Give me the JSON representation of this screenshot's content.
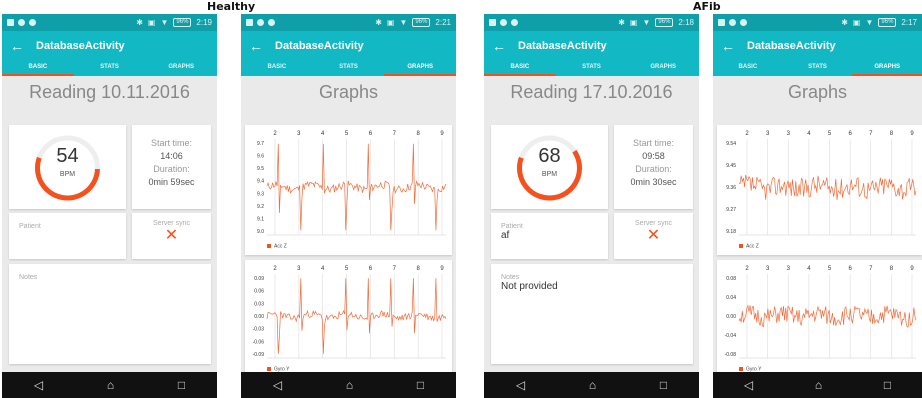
{
  "labels": {
    "healthy": "Healthy",
    "afib": "AFib"
  },
  "screens": [
    {
      "status_time": "2:19",
      "battery": "96%",
      "app_title": "DatabaseActivity",
      "tabs": [
        "BASIC",
        "STATS",
        "GRAPHS"
      ],
      "active_tab": 0,
      "page_title": "Reading 10.11.2016",
      "bpm": "54",
      "bpm_unit": "BPM",
      "bpm_fraction": 0.55,
      "start_label": "Start time:",
      "start_value": "14:06",
      "duration_label": "Duration:",
      "duration_value": "0min 59sec",
      "patient_label": "Patient",
      "patient_value": "",
      "sync_label": "Server sync",
      "sync_icon": "cross-icon",
      "notes_label": "Notes",
      "notes_value": ""
    },
    {
      "status_time": "2:21",
      "battery": "96%",
      "app_title": "DatabaseActivity",
      "tabs": [
        "BASIC",
        "STATS",
        "GRAPHS"
      ],
      "active_tab": 2,
      "page_title": "Graphs",
      "graph1": {
        "legend": "Acc Z",
        "xticks": [
          "2",
          "3",
          "4",
          "5",
          "6",
          "7",
          "8",
          "9"
        ],
        "yticks": [
          "9.7",
          "9.6",
          "9.5",
          "9.4",
          "9.3",
          "9.2",
          "9.1",
          "9.0"
        ]
      },
      "graph2": {
        "legend": "Gyro Y",
        "xticks": [
          "2",
          "3",
          "4",
          "5",
          "6",
          "7",
          "8",
          "9"
        ],
        "yticks": [
          "0.09",
          "0.06",
          "0.03",
          "0.00",
          "-0.03",
          "-0.06",
          "-0.09"
        ]
      }
    },
    {
      "status_time": "2:18",
      "battery": "96%",
      "app_title": "DatabaseActivity",
      "tabs": [
        "BASIC",
        "STATS",
        "GRAPHS"
      ],
      "active_tab": 0,
      "page_title": "Reading 17.10.2016",
      "bpm": "68",
      "bpm_unit": "BPM",
      "bpm_fraction": 0.65,
      "start_label": "Start time:",
      "start_value": "09:58",
      "duration_label": "Duration:",
      "duration_value": "0min 30sec",
      "patient_label": "Patient",
      "patient_value": "af",
      "sync_label": "Server sync",
      "sync_icon": "cross-icon",
      "notes_label": "Notes",
      "notes_value": "Not provided"
    },
    {
      "status_time": "2:17",
      "battery": "96%",
      "app_title": "DatabaseActivity",
      "tabs": [
        "BASIC",
        "STATS",
        "GRAPHS"
      ],
      "active_tab": 2,
      "page_title": "Graphs",
      "graph1": {
        "legend": "Acc Z",
        "xticks": [
          "2",
          "3",
          "3",
          "4",
          "5",
          "6",
          "7",
          "8",
          "9"
        ],
        "yticks": [
          "9.54",
          "9.45",
          "9.36",
          "9.27",
          "9.18"
        ]
      },
      "graph2": {
        "legend": "Gyro Y",
        "xticks": [
          "2",
          "3",
          "3",
          "4",
          "5",
          "6",
          "7",
          "8",
          "9"
        ],
        "yticks": [
          "0.08",
          "0.04",
          "0.00",
          "-0.04",
          "-0.08"
        ]
      }
    }
  ],
  "nav_icons": [
    "back-triangle-icon",
    "home-circle-icon",
    "recents-square-icon"
  ],
  "colors": {
    "statusbar": "#0f9fa8",
    "appbar": "#12b8c4",
    "accent": "#f4511e",
    "trace": "#f26b3a"
  }
}
